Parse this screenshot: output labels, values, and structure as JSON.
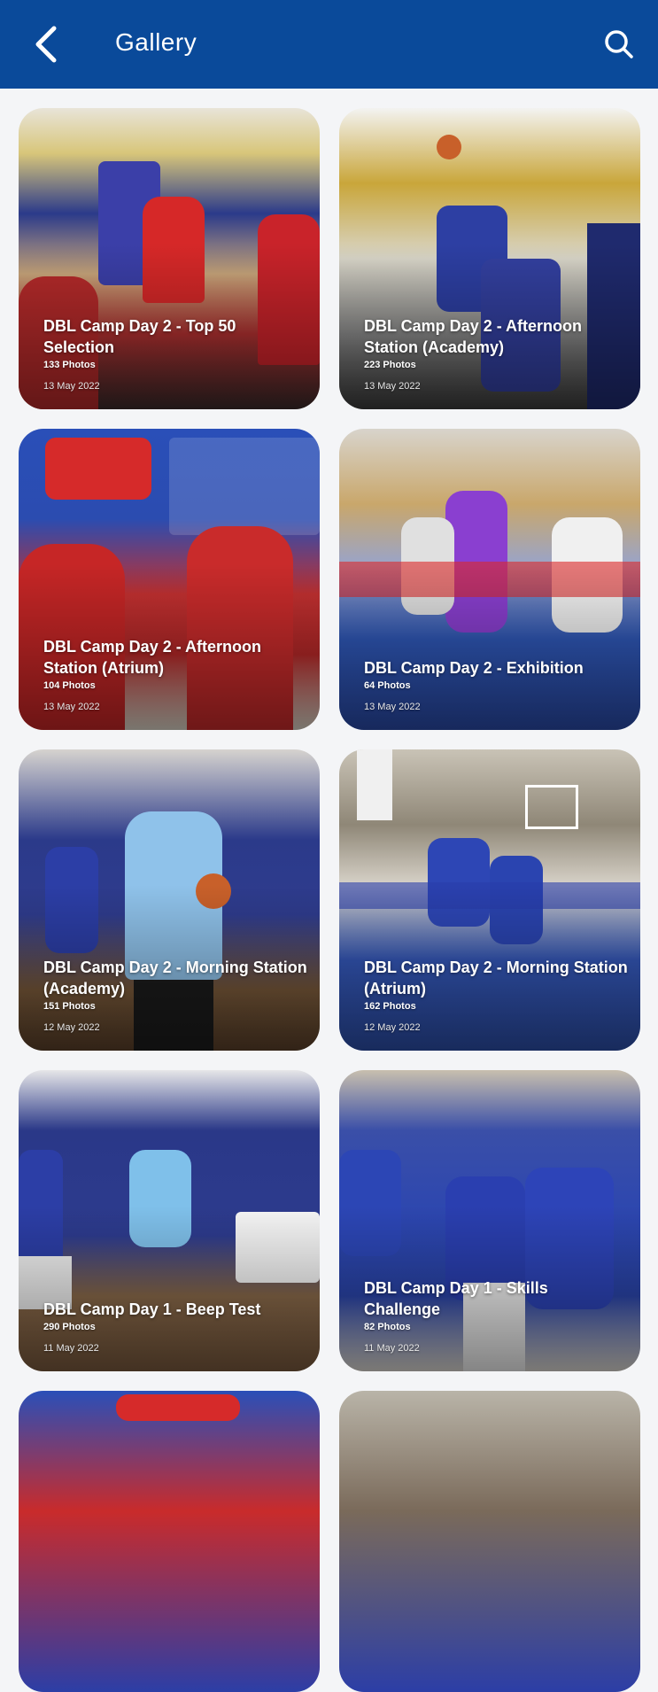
{
  "appbar": {
    "title": "Gallery",
    "back_icon": "chevron-left-icon",
    "search_icon": "search-icon",
    "color": "#0a4a9a"
  },
  "gallery": {
    "items": [
      {
        "title": "DBL Camp Day 2 - Top 50 Selection",
        "count": "133 Photos",
        "date": "13 May 2022"
      },
      {
        "title": "DBL Camp Day 2 - Afternoon Station (Academy)",
        "count": "223 Photos",
        "date": "13 May 2022"
      },
      {
        "title": "DBL Camp Day 2 - Afternoon Station (Atrium)",
        "count": "104 Photos",
        "date": "13 May 2022"
      },
      {
        "title": "DBL Camp Day 2 - Exhibition",
        "count": "64 Photos",
        "date": "13 May 2022"
      },
      {
        "title": "DBL Camp Day 2 - Morning Station (Academy)",
        "count": "151 Photos",
        "date": "12 May 2022"
      },
      {
        "title": "DBL Camp Day 2 - Morning Station (Atrium)",
        "count": "162 Photos",
        "date": "12 May 2022"
      },
      {
        "title": "DBL Camp Day 1 - Beep Test",
        "count": "290 Photos",
        "date": "11 May 2022"
      },
      {
        "title": "DBL Camp Day 1 - Skills Challenge",
        "count": "82 Photos",
        "date": "11 May 2022"
      }
    ]
  }
}
